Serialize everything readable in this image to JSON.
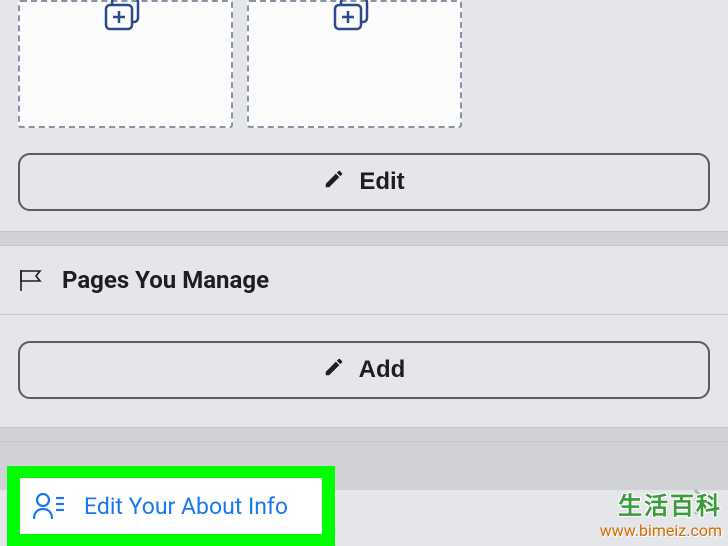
{
  "top": {
    "edit_label": "Edit"
  },
  "pages_section": {
    "title": "Pages You Manage",
    "add_label": "Add"
  },
  "about_row": {
    "label": "Edit Your About Info"
  },
  "watermark": {
    "cn": "生活百科",
    "url": "www.bimeiz.com"
  },
  "icons": {
    "card_plus": "card-plus-icon",
    "pencil": "pencil-icon",
    "flag": "flag-icon",
    "person_lines": "person-lines-icon",
    "chevron_right": "chevron-right-icon"
  }
}
